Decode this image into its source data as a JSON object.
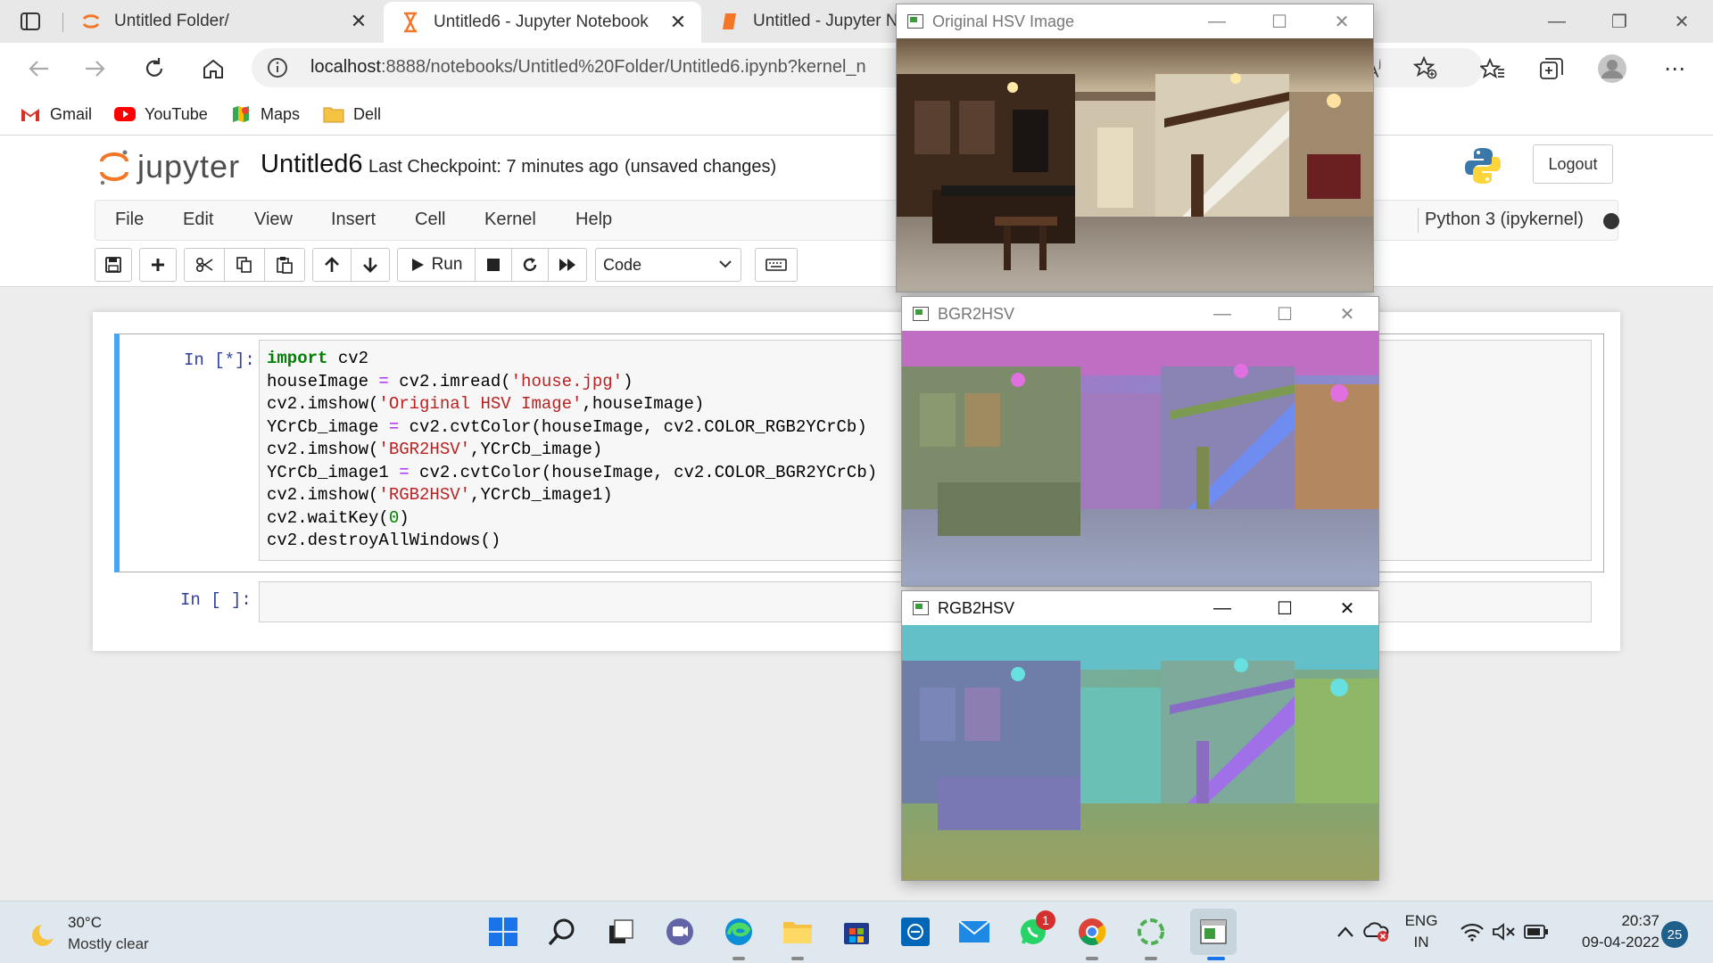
{
  "browser": {
    "tabs": [
      {
        "label": "Untitled Folder/"
      },
      {
        "label": "Untitled6 - Jupyter Notebook"
      },
      {
        "label": "Untitled - Jupyter Nc"
      }
    ],
    "url_host": "localhost",
    "url_rest": ":8888/notebooks/Untitled%20Folder/Untitled6.ipynb?kernel_n",
    "bookmarks": [
      {
        "label": "Gmail"
      },
      {
        "label": "YouTube"
      },
      {
        "label": "Maps"
      },
      {
        "label": "Dell"
      }
    ]
  },
  "jupyter": {
    "logo_text": "jupyter",
    "notebook_title": "Untitled6",
    "checkpoint": "Last Checkpoint: 7 minutes ago",
    "unsaved": "(unsaved changes)",
    "logout": "Logout",
    "menu": [
      "File",
      "Edit",
      "View",
      "Insert",
      "Cell",
      "Kernel",
      "Help"
    ],
    "kernel": "Python 3 (ipykernel)",
    "toolbar": {
      "run_label": "Run",
      "cell_type": "Code"
    },
    "cells": [
      {
        "prompt": "In [*]:",
        "lines": [
          [
            {
              "t": "import",
              "c": "kw"
            },
            {
              "t": " cv2",
              "c": ""
            }
          ],
          [
            {
              "t": "houseImage ",
              "c": ""
            },
            {
              "t": "=",
              "c": "op"
            },
            {
              "t": " cv2.imread(",
              "c": ""
            },
            {
              "t": "'house.jpg'",
              "c": "str"
            },
            {
              "t": ")",
              "c": ""
            }
          ],
          [
            {
              "t": "cv2.imshow(",
              "c": ""
            },
            {
              "t": "'Original HSV Image'",
              "c": "str"
            },
            {
              "t": ",houseImage)",
              "c": ""
            }
          ],
          [
            {
              "t": "YCrCb_image ",
              "c": ""
            },
            {
              "t": "=",
              "c": "op"
            },
            {
              "t": " cv2.cvtColor(houseImage, cv2.COLOR_RGB2YCrCb)",
              "c": ""
            }
          ],
          [
            {
              "t": "cv2.imshow(",
              "c": ""
            },
            {
              "t": "'BGR2HSV'",
              "c": "str"
            },
            {
              "t": ",YCrCb_image)",
              "c": ""
            }
          ],
          [
            {
              "t": "YCrCb_image1 ",
              "c": ""
            },
            {
              "t": "=",
              "c": "op"
            },
            {
              "t": " cv2.cvtColor(houseImage, cv2.COLOR_BGR2YCrCb)",
              "c": ""
            }
          ],
          [
            {
              "t": "cv2.imshow(",
              "c": ""
            },
            {
              "t": "'RGB2HSV'",
              "c": "str"
            },
            {
              "t": ",YCrCb_image1)",
              "c": ""
            }
          ],
          [
            {
              "t": "cv2.waitKey(",
              "c": ""
            },
            {
              "t": "0",
              "c": "num"
            },
            {
              "t": ")",
              "c": ""
            }
          ],
          [
            {
              "t": "cv2.destroyAllWindows()",
              "c": ""
            }
          ]
        ]
      },
      {
        "prompt": "In [ ]:"
      }
    ]
  },
  "cv_windows": [
    {
      "title": "Original HSV Image"
    },
    {
      "title": "BGR2HSV"
    },
    {
      "title": "RGB2HSV"
    }
  ],
  "taskbar": {
    "temperature": "30°C",
    "weather": "Mostly clear",
    "lang_top": "ENG",
    "lang_bottom": "IN",
    "time": "20:37",
    "date": "09-04-2022",
    "notifications": "25",
    "whatsapp_badge": "1"
  },
  "colors": {
    "jupyter_orange": "#f37726",
    "cell_selected": "#42a5f5",
    "prompt_blue": "#303f9f"
  }
}
